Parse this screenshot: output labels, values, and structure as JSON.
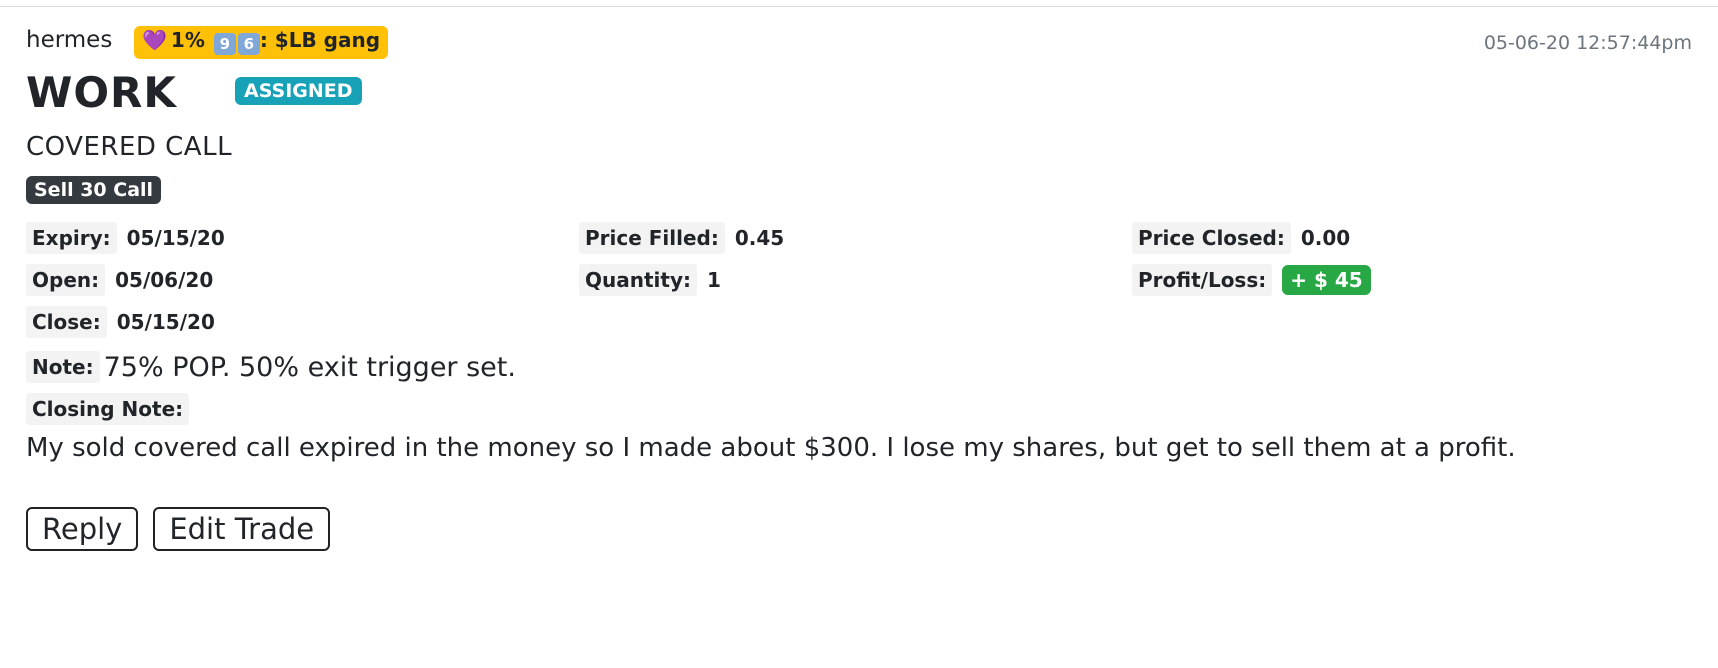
{
  "post": {
    "author": "hermes",
    "gang_badge": {
      "heart": "💜",
      "percent": "1%",
      "keycap_1": "9",
      "keycap_2": "6",
      "suffix": ": $LB gang",
      "color": "#ffc107"
    },
    "timestamp": "05-06-20 12:57:44pm",
    "ticker": "WORK",
    "status": "ASSIGNED",
    "strategy": "COVERED CALL",
    "leg": "Sell 30 Call"
  },
  "details": {
    "expiry_label": "Expiry:",
    "expiry_value": "05/15/20",
    "price_filled_label": "Price Filled:",
    "price_filled_value": "0.45",
    "price_closed_label": "Price Closed:",
    "price_closed_value": "0.00",
    "open_label": "Open:",
    "open_value": "05/06/20",
    "quantity_label": "Quantity:",
    "quantity_value": "1",
    "profit_loss_label": "Profit/Loss:",
    "profit_loss_value": "+ $ 45",
    "close_label": "Close:",
    "close_value": "05/15/20"
  },
  "notes": {
    "note_label": "Note:",
    "note_text": "75% POP. 50% exit trigger set.",
    "closing_label": "Closing Note:",
    "closing_text": "My sold covered call expired in the money so I made about $300. I lose my shares, but get to sell them at a profit."
  },
  "actions": {
    "reply_label": "Reply",
    "edit_label": "Edit Trade"
  },
  "colors": {
    "assigned": "#17a2b8",
    "leg": "#343a40",
    "profit": "#28a745",
    "gang": "#ffc107"
  }
}
